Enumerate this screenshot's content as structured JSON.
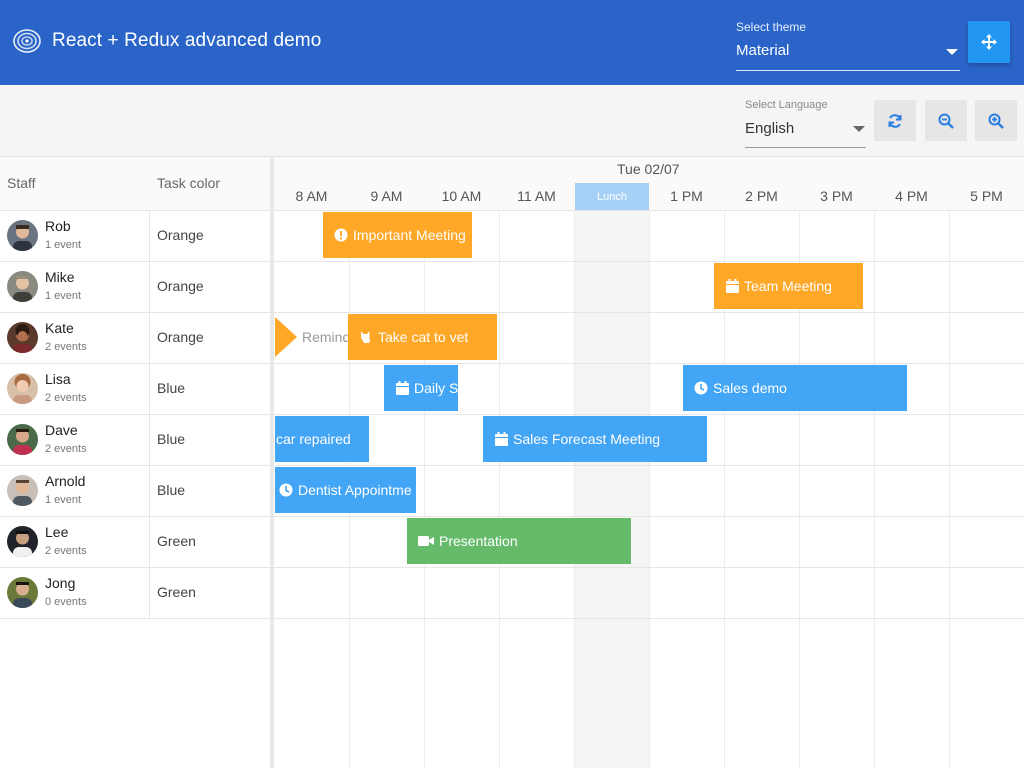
{
  "header": {
    "title": "React + Redux advanced demo",
    "theme_label": "Select theme",
    "theme_value": "Material"
  },
  "toolbar": {
    "language_label": "Select Language",
    "language_value": "English"
  },
  "grid": {
    "staff_header": "Staff",
    "color_header": "Task color",
    "date": "Tue 02/07",
    "hours": [
      "8 AM",
      "9 AM",
      "10 AM",
      "11 AM",
      "Lunch",
      "1 PM",
      "2 PM",
      "3 PM",
      "4 PM",
      "5 PM"
    ]
  },
  "staff": [
    {
      "name": "Rob",
      "events": "1 event",
      "color": "Orange"
    },
    {
      "name": "Mike",
      "events": "1 event",
      "color": "Orange"
    },
    {
      "name": "Kate",
      "events": "2 events",
      "color": "Orange"
    },
    {
      "name": "Lisa",
      "events": "2 events",
      "color": "Blue"
    },
    {
      "name": "Dave",
      "events": "2 events",
      "color": "Blue"
    },
    {
      "name": "Arnold",
      "events": "1 event",
      "color": "Blue"
    },
    {
      "name": "Lee",
      "events": "2 events",
      "color": "Green"
    },
    {
      "name": "Jong",
      "events": "0 events",
      "color": "Green"
    }
  ],
  "events": [
    {
      "name": "Important Meeting",
      "icon": "exclamation-circle-icon",
      "color": "orange"
    },
    {
      "name": "Team Meeting",
      "icon": "calendar-icon",
      "color": "orange"
    },
    {
      "name": "Remind",
      "icon": "reminder-flag-icon",
      "color": "orange"
    },
    {
      "name": "Take cat to vet",
      "icon": "cat-icon",
      "color": "orange"
    },
    {
      "name": "Daily S",
      "icon": "calendar-icon",
      "color": "blue"
    },
    {
      "name": "Sales demo",
      "icon": "clock-icon",
      "color": "blue"
    },
    {
      "name": "car repaired",
      "icon": "",
      "color": "blue"
    },
    {
      "name": "Sales Forecast Meeting",
      "icon": "calendar-icon",
      "color": "blue"
    },
    {
      "name": "Dentist Appointme",
      "icon": "clock-icon",
      "color": "blue"
    },
    {
      "name": "Presentation",
      "icon": "video-icon",
      "color": "green"
    }
  ],
  "colors": {
    "header_bg": "#2a64c8",
    "accent_button": "#2196f3",
    "orange": "#ffa726",
    "blue": "#42a5f5",
    "green": "#66bb6a",
    "lunch": "#a6d0f6"
  }
}
